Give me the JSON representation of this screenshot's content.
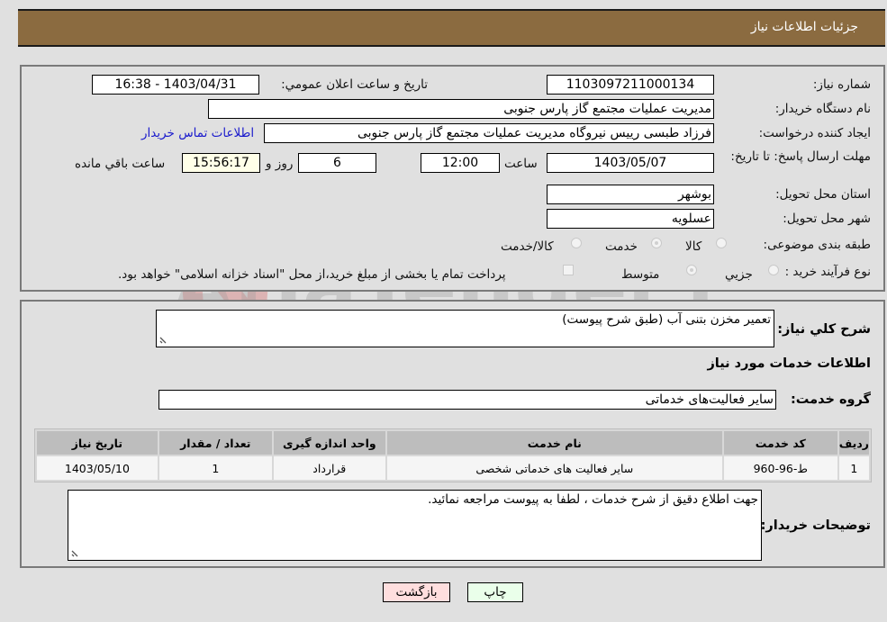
{
  "header": {
    "title": "جزئیات اطلاعات نیاز"
  },
  "form": {
    "need_number": {
      "label": "شماره نیاز:",
      "value": "1103097211000134"
    },
    "announce_datetime": {
      "label": "تاریخ و ساعت اعلان عمومي:",
      "value": "1403/04/31 - 16:38"
    },
    "buyer_org": {
      "label": "نام دستگاه خريدار:",
      "value": "مديريت عمليات مجتمع گاز پارس جنوبی"
    },
    "requester": {
      "label": "ايجاد كننده درخواست:",
      "value": "فرزاد طبسی رییس نیروگاه مدیریت عملیات مجتمع گاز پارس جنوبی"
    },
    "buyer_contact_link": "اطلاعات تماس خريدار",
    "deadline": {
      "label": "مهلت ارسال پاسخ: تا تاريخ:",
      "date": "1403/05/07",
      "time_label": "ساعت",
      "time": "12:00",
      "days": "6",
      "days_label": "روز و",
      "remaining": "15:56:17",
      "remaining_label": "ساعت باقي مانده"
    },
    "province": {
      "label": "استان محل تحويل:",
      "value": "بوشهر"
    },
    "city": {
      "label": "شهر محل تحويل:",
      "value": "عسلويه"
    },
    "category": {
      "label": "طبقه بندی موضوعی:",
      "options": [
        {
          "label": "كالا",
          "checked": false
        },
        {
          "label": "خدمت",
          "checked": true
        },
        {
          "label": "كالا/خدمت",
          "checked": false
        }
      ]
    },
    "purchase_type": {
      "label": "نوع فرآيند خريد :",
      "options": [
        {
          "label": "جزيي",
          "checked": false
        },
        {
          "label": "متوسط",
          "checked": true
        }
      ],
      "treasury_note": "پرداخت تمام يا بخشی از مبلغ خريد،از محل \"اسناد خزانه اسلامی\" خواهد بود.",
      "treasury_checked": false
    }
  },
  "details": {
    "general_desc_label": "شرح كلي نياز:",
    "general_desc": "تعمیر مخزن بتنی آب (طبق شرح پیوست)",
    "services_heading": "اطلاعات خدمات مورد نياز",
    "service_group_label": "گروه خدمت:",
    "service_group": "ساير فعاليت‌هاى خدماتى",
    "table": {
      "headers": [
        "رديف",
        "كد خدمت",
        "نام خدمت",
        "واحد اندازه گيری",
        "تعداد / مقدار",
        "تاريخ نياز"
      ],
      "rows": [
        [
          "1",
          "ط-96-960",
          "ساير فعاليت هاى خدماتى شخصى",
          "قرارداد",
          "1",
          "1403/05/10"
        ]
      ]
    },
    "buyer_notes_label": "توضيحات خريدار:",
    "buyer_notes": "جهت اطلاع دقيق از شرح خدمات ، لطفا به پیوست مراجعه نمائید."
  },
  "buttons": {
    "print": "چاپ",
    "back": "بازگشت"
  },
  "watermark": "AriaTender.neT",
  "colors": {
    "header_bg": "#8b6b40",
    "print_bg": "#eaffea",
    "back_bg": "#ffdede",
    "link": "#1a1acc"
  }
}
